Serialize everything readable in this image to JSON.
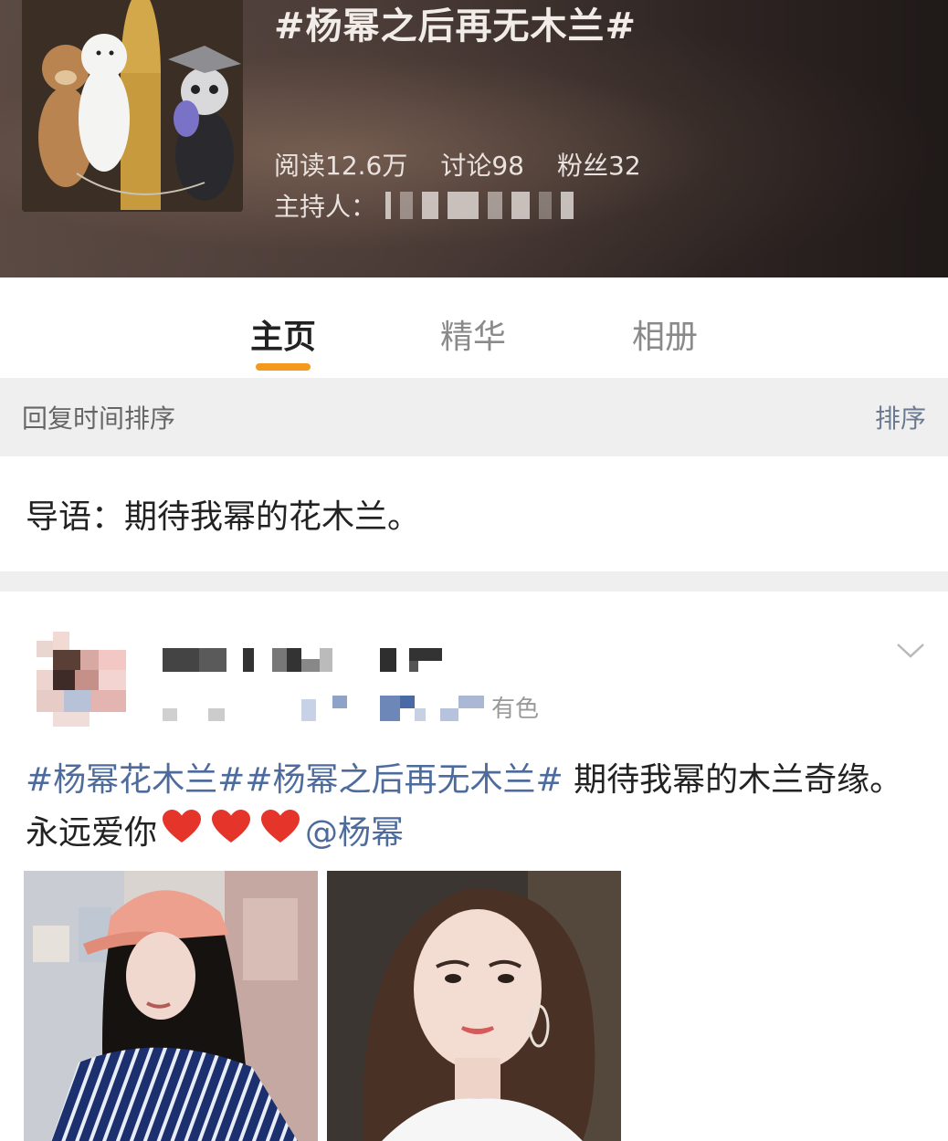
{
  "header": {
    "title": "#杨幂之后再无木兰#",
    "stats": {
      "read": "阅读12.6万",
      "discuss": "讨论98",
      "fans": "粉丝32"
    },
    "host_label": "主持人："
  },
  "tabs": [
    {
      "label": "主页",
      "active": true
    },
    {
      "label": "精华",
      "active": false
    },
    {
      "label": "相册",
      "active": false
    }
  ],
  "sortbar": {
    "label": "回复时间排序",
    "sort_button": "排序"
  },
  "intro": {
    "text": "导语：期待我幂的花木兰。"
  },
  "post": {
    "meta_suffix": "有色",
    "text": {
      "tag1": "#杨幂花木兰#",
      "tag2": "#杨幂之后再无木兰#",
      "body1": " 期待我幂的木兰奇缘。永远爱你",
      "mention": "@杨幂"
    }
  },
  "colors": {
    "accent": "#f39a1c",
    "link": "#4d6b9c",
    "gray_bg": "#efefef"
  },
  "icons": {
    "more": "chevron-down-icon",
    "heart": "heart-icon"
  }
}
